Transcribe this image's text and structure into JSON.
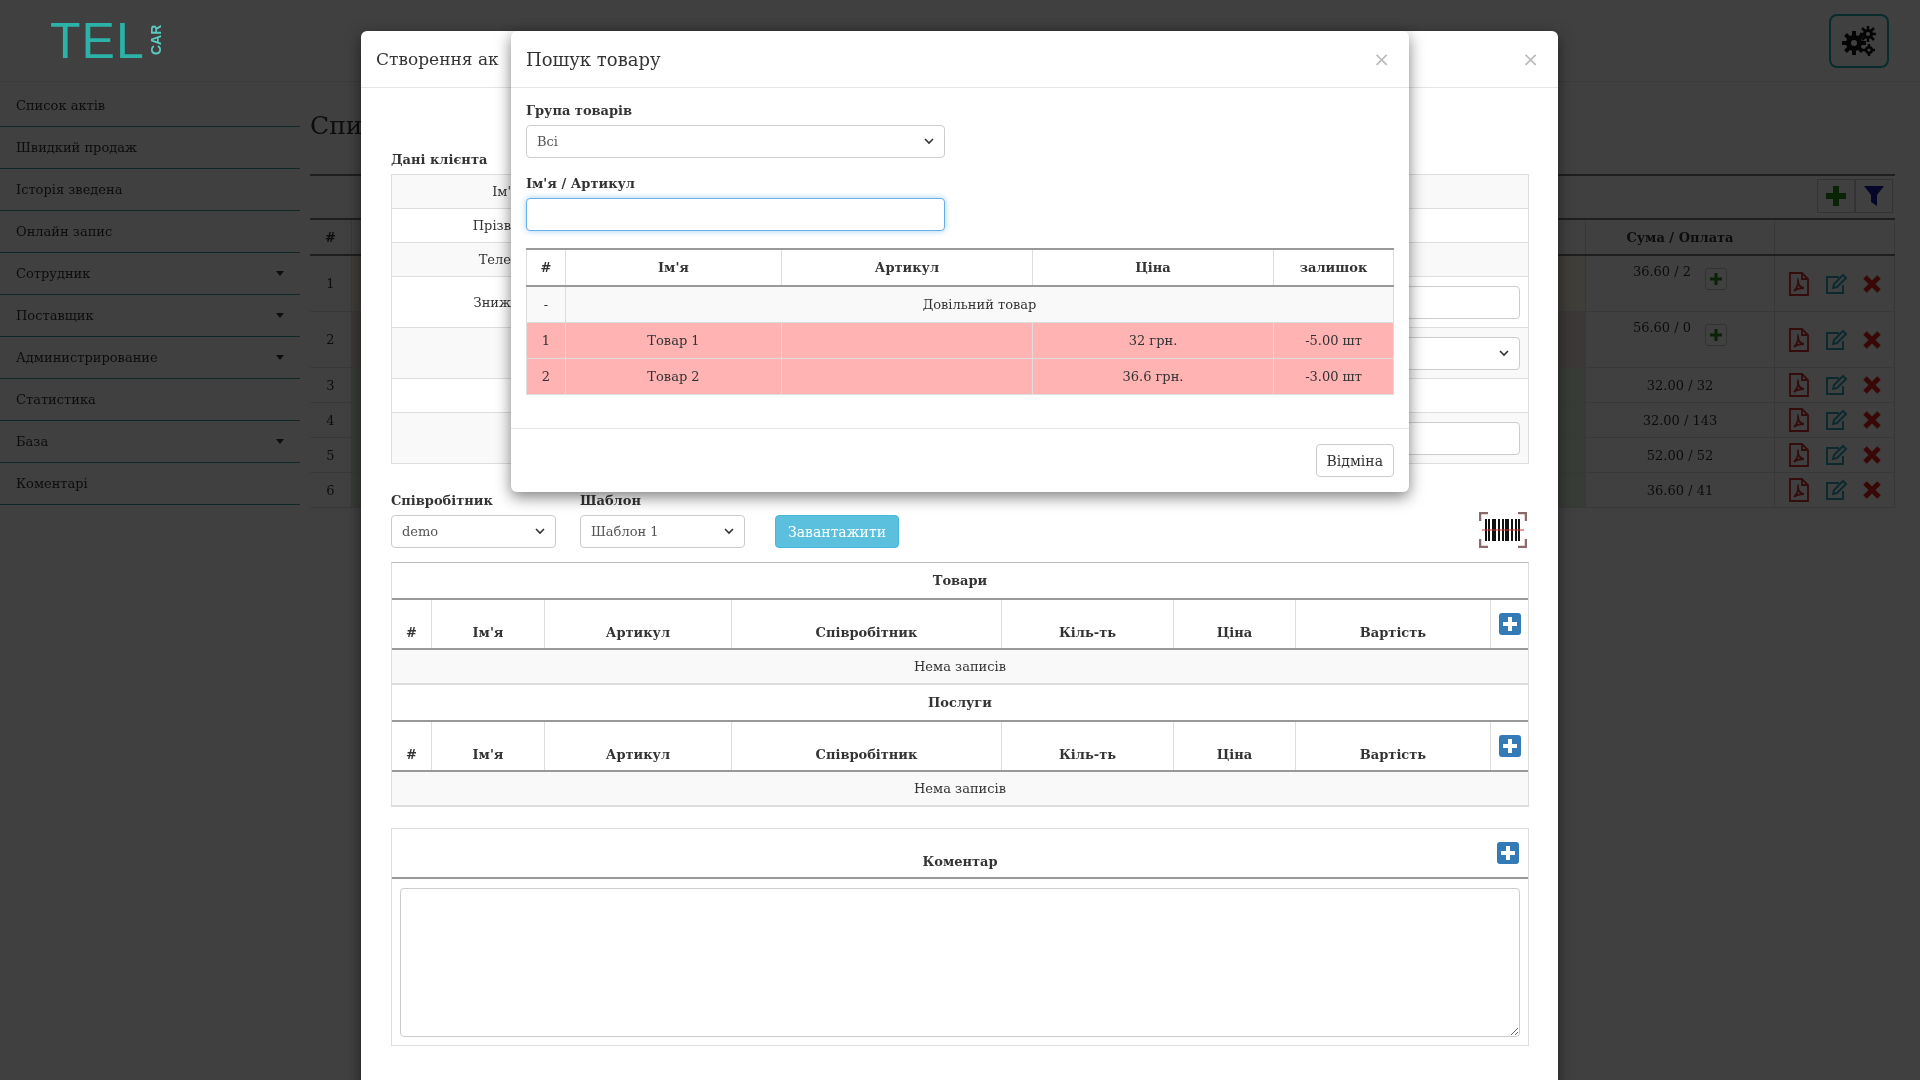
{
  "header": {
    "logo": {
      "text": "TEL",
      "sub": "CAR"
    }
  },
  "sidebar": {
    "items": [
      {
        "label": "Список актів",
        "kind": "link"
      },
      {
        "label": "Швидкий продаж",
        "kind": "link"
      },
      {
        "label": "Історія зведена",
        "kind": "link"
      },
      {
        "label": "Онлайн запис",
        "kind": "link"
      },
      {
        "label": "Сотрудник",
        "kind": "submenu"
      },
      {
        "label": "Поставщик",
        "kind": "submenu"
      },
      {
        "label": "Администрирование",
        "kind": "submenu"
      },
      {
        "label": "Статистика",
        "kind": "link"
      },
      {
        "label": "База",
        "kind": "submenu"
      },
      {
        "label": "Коментарі",
        "kind": "link"
      }
    ]
  },
  "page": {
    "title": "Спи",
    "table": {
      "columns": [
        "#",
        "Сума / Оплата"
      ],
      "rows": [
        {
          "number": "1",
          "total": "36.60 / 2",
          "color": "#fcf8e3",
          "pay_button": true
        },
        {
          "number": "2",
          "total": "56.60 / 0",
          "color": "#f2dede",
          "pay_button": true
        },
        {
          "number": "3",
          "total": "32.00 / 32",
          "color": "#dff0d8",
          "pay_button": false
        },
        {
          "number": "4",
          "total": "32.00 / 143",
          "color": "#dff0d8",
          "pay_button": false
        },
        {
          "number": "5",
          "total": "52.00 / 52",
          "color": "#dff0d8",
          "pay_button": false
        },
        {
          "number": "6",
          "total": "36.60 / 41",
          "color": "#dff0d8",
          "pay_button": false
        }
      ]
    }
  },
  "act_modal": {
    "title": "Створення ак",
    "close": "×",
    "client": {
      "title": "Дані клієнта",
      "rows": [
        {
          "label": "Ім'",
          "kind": "plain"
        },
        {
          "label": "Прізв",
          "kind": "plain"
        },
        {
          "label": "Теле",
          "kind": "plain"
        },
        {
          "label": "Зниж",
          "kind": "input"
        },
        {
          "kind": "select"
        },
        {
          "kind": "plain"
        },
        {
          "kind": "input"
        }
      ]
    },
    "employee": {
      "label": "Співробітник",
      "value": "demo"
    },
    "template": {
      "label": "Шаблон",
      "value": "Шаблон 1"
    },
    "load_button": "Завантажити",
    "sections": [
      {
        "title": "Товари",
        "columns": [
          "#",
          "Ім'я",
          "Артикул",
          "Співробітник",
          "Кіль-ть",
          "Ціна",
          "Вартість"
        ],
        "empty": "Нема записів"
      },
      {
        "title": "Послуги",
        "columns": [
          "#",
          "Ім'я",
          "Артикул",
          "Співробітник",
          "Кіль-ть",
          "Ціна",
          "Вартість"
        ],
        "empty": "Нема записів"
      }
    ],
    "comment": {
      "title": "Коментар"
    }
  },
  "search_modal": {
    "title": "Пошук товару",
    "close": "×",
    "group": {
      "label": "Група товарів",
      "value": "Всі"
    },
    "query": {
      "label": "Ім'я / Артикул",
      "focused": true
    },
    "table": {
      "columns": [
        "#",
        "Ім'я",
        "Артикул",
        "Ціна",
        "залишок"
      ],
      "rows": [
        {
          "kind": "custom",
          "number": "-",
          "name": "Довільний товар",
          "color": "#f9f9f9"
        },
        {
          "kind": "item",
          "number": "1",
          "name": "Товар 1",
          "price": "32 грн.",
          "stock": "-5.00 шт",
          "color": "#ffb3b3"
        },
        {
          "kind": "item",
          "number": "2",
          "name": "Товар 2",
          "price": "36.6 грн.",
          "stock": "-3.00 шт",
          "color": "#ffb3b3"
        }
      ]
    },
    "cancel_button": "Відміна"
  }
}
